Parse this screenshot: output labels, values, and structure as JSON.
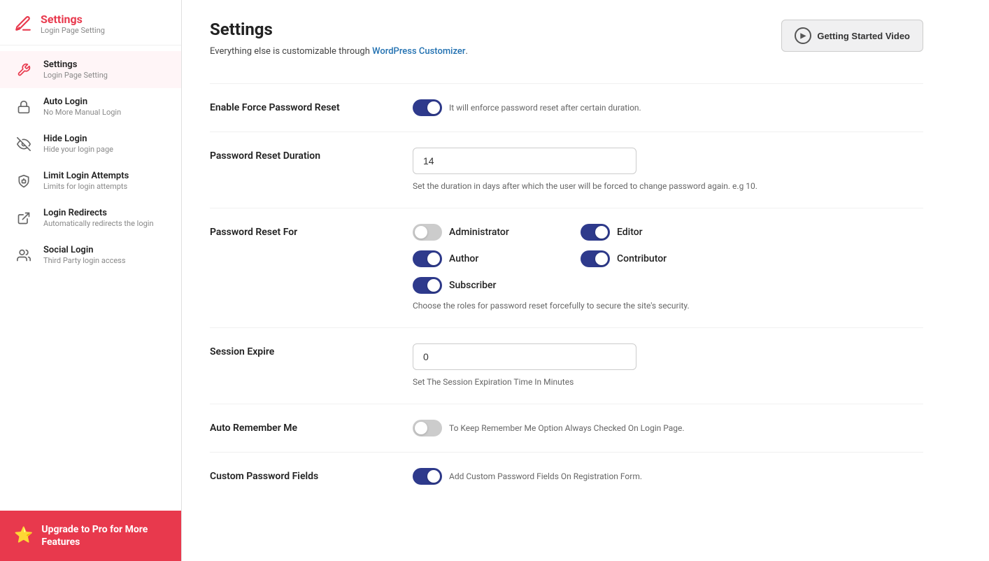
{
  "sidebar": {
    "header": {
      "title": "Settings",
      "subtitle": "Login Page Setting"
    },
    "items": [
      {
        "id": "settings",
        "label": "Settings",
        "desc": "Login Page Setting",
        "icon": "wrench",
        "active": true
      },
      {
        "id": "auto-login",
        "label": "Auto Login",
        "desc": "No More Manual Login",
        "icon": "lock",
        "active": false
      },
      {
        "id": "hide-login",
        "label": "Hide Login",
        "desc": "Hide your login page",
        "icon": "eye-slash",
        "active": false
      },
      {
        "id": "limit-login",
        "label": "Limit Login Attempts",
        "desc": "Limits for login attempts",
        "icon": "shield",
        "active": false
      },
      {
        "id": "login-redirects",
        "label": "Login Redirects",
        "desc": "Automatically redirects the login",
        "icon": "external-link",
        "active": false
      },
      {
        "id": "social-login",
        "label": "Social Login",
        "desc": "Third Party login access",
        "icon": "user-group",
        "active": false
      }
    ],
    "upgrade": {
      "label": "Upgrade to Pro for More Features",
      "star": "⭐"
    }
  },
  "main": {
    "title": "Settings",
    "subtitle_text": "Everything else is customizable through ",
    "subtitle_link": "WordPress Customizer",
    "subtitle_end": ".",
    "getting_started_button": "Getting Started Video",
    "sections": [
      {
        "id": "enable-force-password",
        "label": "Enable Force Password Reset",
        "type": "toggle",
        "toggle_checked": true,
        "description": "It will enforce password reset after certain duration."
      },
      {
        "id": "password-reset-duration",
        "label": "Password Reset Duration",
        "type": "input",
        "value": "14",
        "description": "Set the duration in days after which the user will be forced to change password again. e.g 10."
      },
      {
        "id": "password-reset-for",
        "label": "Password Reset For",
        "type": "roles",
        "roles": [
          {
            "id": "administrator",
            "label": "Administrator",
            "checked": false
          },
          {
            "id": "editor",
            "label": "Editor",
            "checked": true
          },
          {
            "id": "author",
            "label": "Author",
            "checked": true
          },
          {
            "id": "contributor",
            "label": "Contributor",
            "checked": true
          },
          {
            "id": "subscriber",
            "label": "Subscriber",
            "checked": true
          }
        ],
        "description": "Choose the roles for password reset forcefully to secure the site's security."
      },
      {
        "id": "session-expire",
        "label": "Session Expire",
        "type": "input",
        "value": "0",
        "description": "Set The Session Expiration Time In Minutes"
      },
      {
        "id": "auto-remember-me",
        "label": "Auto Remember Me",
        "type": "toggle",
        "toggle_checked": false,
        "description": "To Keep Remember Me Option Always Checked On Login Page."
      },
      {
        "id": "custom-password-fields",
        "label": "Custom Password Fields",
        "type": "toggle",
        "toggle_checked": true,
        "description": "Add Custom Password Fields On Registration Form."
      }
    ]
  }
}
